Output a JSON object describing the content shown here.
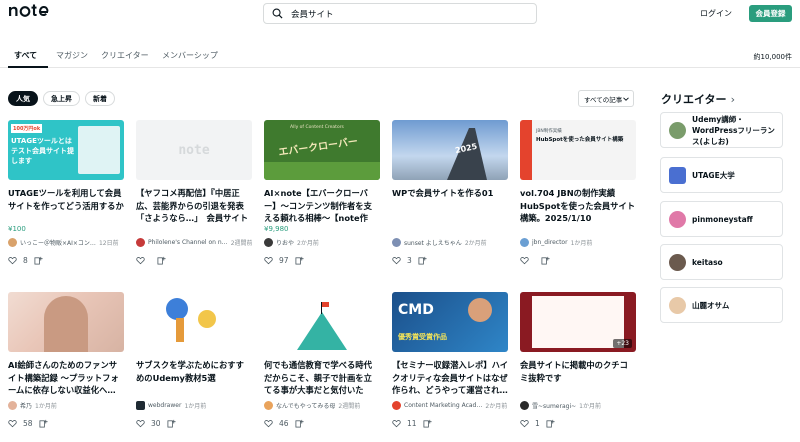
{
  "header": {
    "logo": "note",
    "search_value": "会員サイト",
    "login": "ログイン",
    "signup": "会員登録"
  },
  "tabs": [
    "すべて",
    "マガジン",
    "クリエイター",
    "メンバーシップ"
  ],
  "result_count": "約10,000件",
  "filters": [
    "人気",
    "急上昇",
    "新着"
  ],
  "sort": "すべての記事",
  "cards": [
    {
      "title": "UTAGEツールを利用して会員サイトを作ってどう活用するか",
      "price": "¥100",
      "author": "いっこー＠物販×AI×コン…",
      "date": "12日前",
      "likes": "8",
      "thumb_text": "UTAGEツールとはテスト会員サイト提します",
      "thumb_label": "100万円ok"
    },
    {
      "title": "【ヤフコメ再配信】『中居正広、芸能界からの引退を発表「さようなら…」　会員サイトで報…",
      "price": "",
      "author": "Philolene's Channel on n…",
      "date": "2週間前",
      "likes": "",
      "thumb_text": "note",
      "thumb_label": ""
    },
    {
      "title": "AI×note【エバークローバー】〜コンテンツ制作者を支える頼れる相棒〜【note作成…",
      "price": "¥9,980",
      "author": "りおや",
      "date": "2か月前",
      "likes": "97",
      "thumb_text": "エバークローバー",
      "thumb_label": "Ally of Content Creators"
    },
    {
      "title": "WPで会員サイトを作る01",
      "price": "",
      "author": "sunset よしえちゃん",
      "date": "2か月前",
      "likes": "3",
      "thumb_text": "2025",
      "thumb_label": ""
    },
    {
      "title": "vol.704 JBNの制作実績HubSpotを使った会員サイト構築。2025/1/10",
      "price": "",
      "author": "jbn_director",
      "date": "1か月前",
      "likes": "",
      "thumb_text": "HubSpotを使った会員サイト構築",
      "thumb_label": "JBN制作実績"
    },
    {
      "title": "AI絵師さんのためのファンサイト構築記録 〜プラットフォームに依存しない収益化へ…",
      "price": "",
      "author": "希乃",
      "date": "1か月前",
      "likes": "58",
      "thumb_text": "",
      "thumb_label": ""
    },
    {
      "title": "サブスクを学ぶためにおすすめのUdemy教材5選",
      "price": "",
      "author": "webdrawer",
      "date": "1か月前",
      "likes": "30",
      "thumb_text": "",
      "thumb_label": ""
    },
    {
      "title": "何でも通信教育で学べる時代だからこそ、親子で計画を立てる事が大事だと気付いた話。",
      "price": "",
      "author": "なんでもやってみる母",
      "date": "2週間前",
      "likes": "46",
      "thumb_text": "",
      "thumb_label": ""
    },
    {
      "title": "【セミナー収録潜入レポ】ハイクオリティな会員サイトはなぜ作られ、どうやって運営され…",
      "price": "",
      "author": "Content Marketing Acad…",
      "date": "2か月前",
      "likes": "11",
      "thumb_text": "CMD",
      "thumb_label": "優秀賞受賞作品"
    },
    {
      "title": "会員サイトに掲載中のクチコミ抜粋です",
      "price": "",
      "author": "雪~sumeragi~",
      "date": "1か月前",
      "likes": "1",
      "thumb_text": "+23",
      "thumb_label": ""
    }
  ],
  "sidebar": {
    "title": "クリエイター",
    "creators": [
      "Udemy講師・WordPressフリーランス(よしお)",
      "UTAGE大学",
      "pinmoneystaff",
      "keitaso",
      "山麗オサム"
    ]
  }
}
